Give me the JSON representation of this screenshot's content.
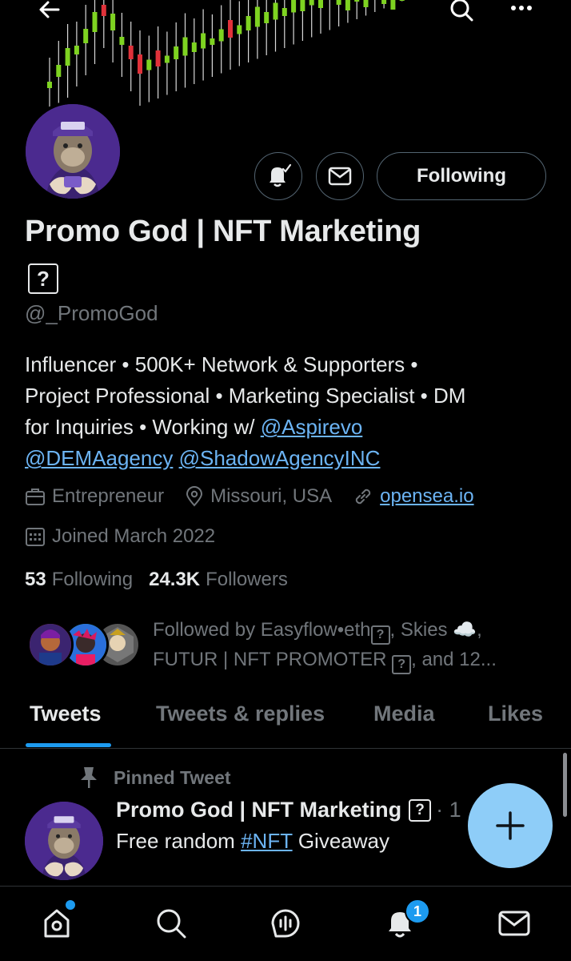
{
  "profile": {
    "name": "Promo God | NFT Marketing",
    "name_emoji_fallback": "?",
    "handle": "@_PromoGod",
    "bio": {
      "line1": "Influencer • 500K+ Network & Supporters •",
      "line2": "Project Professional • Marketing Specialist • DM",
      "line3_prefix": "for Inquiries • Working w/ ",
      "mention1": "@Aspirevo",
      "mention2": "@DEMAagency",
      "mention3": "@ShadowAgencyINC"
    },
    "occupation": "Entrepreneur",
    "location": "Missouri, USA",
    "website": "opensea.io",
    "joined": "Joined March 2022",
    "following_count": "53",
    "following_label": "Following",
    "followers_count": "24.3K",
    "followers_label": "Followers",
    "followed_by": {
      "line1_a": "Followed by Easyflow•eth",
      "line1_b": ", Skies ☁️,",
      "line2_a": "FUTUR | NFT PROMOTER ",
      "line2_b": ", and 12..."
    },
    "follow_button": "Following"
  },
  "tabs": [
    "Tweets",
    "Tweets & replies",
    "Media",
    "Likes"
  ],
  "active_tab": "Tweets",
  "pinned": {
    "label": "Pinned Tweet",
    "author": "Promo God | NFT Marketing",
    "dot": "· 1",
    "text_prefix": "Free random ",
    "hashtag": "#NFT",
    "text_suffix": " Giveaway"
  },
  "nav": {
    "notifications_badge": "1"
  },
  "icons": [
    "back-arrow-icon",
    "search-icon",
    "more-icon",
    "bell-check-icon",
    "mail-icon",
    "briefcase-icon",
    "location-pin-icon",
    "link-icon",
    "calendar-icon",
    "pin-icon",
    "plus-icon",
    "home-icon",
    "spaces-icon",
    "notification-bell-icon"
  ],
  "colors": {
    "accent": "#1d9bf0",
    "link": "#6cb4f4",
    "fab": "#8ecdf8",
    "muted": "#71767b",
    "candle_up": "#7ed321",
    "candle_down": "#e0323a"
  }
}
